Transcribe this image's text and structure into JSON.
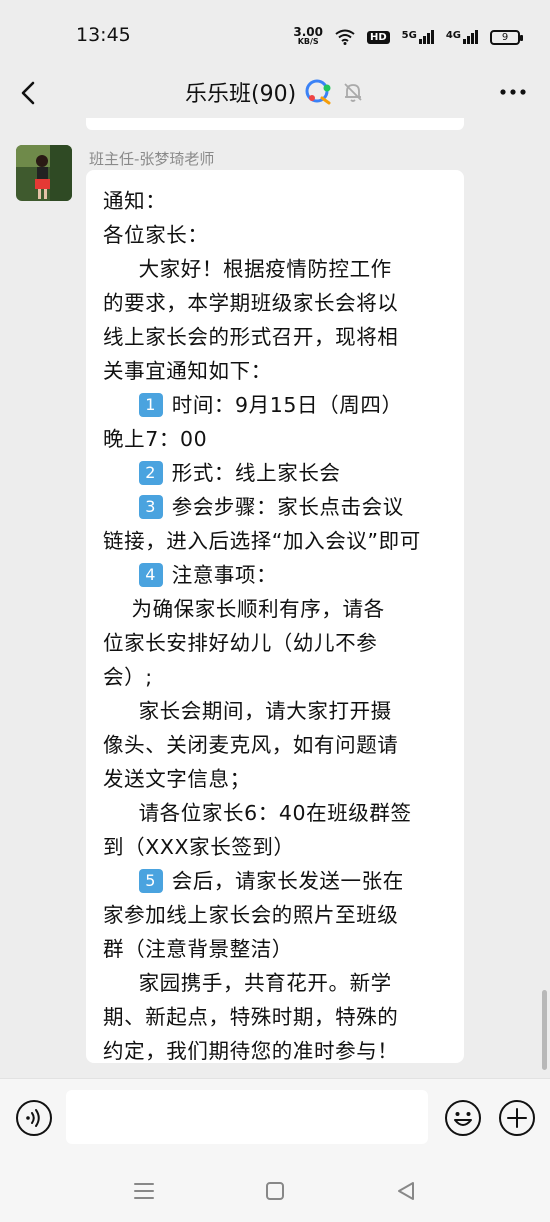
{
  "status_bar": {
    "time": "13:45",
    "net_speed_value": "3.00",
    "net_speed_unit": "KB/S",
    "hd_label": "HD",
    "sim1_label": "5G",
    "sim2_label": "4G",
    "battery_level": "9"
  },
  "header": {
    "title": "乐乐班(90)"
  },
  "message": {
    "sender": "班主任-张梦琦老师",
    "lines": [
      {
        "num": "",
        "text": "通知："
      },
      {
        "num": "",
        "text": "各位家长："
      },
      {
        "num": "",
        "text": "     大家好！根据疫情防控工作"
      },
      {
        "num": "",
        "text": "的要求，本学期班级家长会将以"
      },
      {
        "num": "",
        "text": "线上家长会的形式召开，现将相"
      },
      {
        "num": "",
        "text": "关事宜通知如下："
      },
      {
        "num": "1",
        "text": "时间：9月15日（周四）"
      },
      {
        "num": "",
        "text": "晚上7：00"
      },
      {
        "num": "2",
        "text": "形式：线上家长会"
      },
      {
        "num": "3",
        "text": "参会步骤：家长点击会议"
      },
      {
        "num": "",
        "text": "链接，进入后选择“加入会议”即可"
      },
      {
        "num": "4",
        "text": "注意事项："
      },
      {
        "num": "",
        "text": "    为确保家长顺利有序，请各"
      },
      {
        "num": "",
        "text": "位家长安排好幼儿（幼儿不参"
      },
      {
        "num": "",
        "text": "会）;"
      },
      {
        "num": "",
        "text": "     家长会期间，请大家打开摄"
      },
      {
        "num": "",
        "text": "像头、关闭麦克风，如有问题请"
      },
      {
        "num": "",
        "text": "发送文字信息；"
      },
      {
        "num": "",
        "text": "     请各位家长6：40在班级群签"
      },
      {
        "num": "",
        "text": "到（XXX家长签到）"
      },
      {
        "num": "5",
        "text": "会后，请家长发送一张在"
      },
      {
        "num": "",
        "text": "家参加线上家长会的照片至班级"
      },
      {
        "num": "",
        "text": "群（注意背景整洁）"
      },
      {
        "num": "",
        "text": "     家园携手，共育花开。新学"
      },
      {
        "num": "",
        "text": "期、新起点，特殊时期，特殊的"
      },
      {
        "num": "",
        "text": "约定，我们期待您的准时参与！"
      }
    ]
  },
  "input": {
    "placeholder": ""
  },
  "colors": {
    "background": "#ededed",
    "bubble": "#ffffff",
    "keycap": "#4aa3df"
  }
}
